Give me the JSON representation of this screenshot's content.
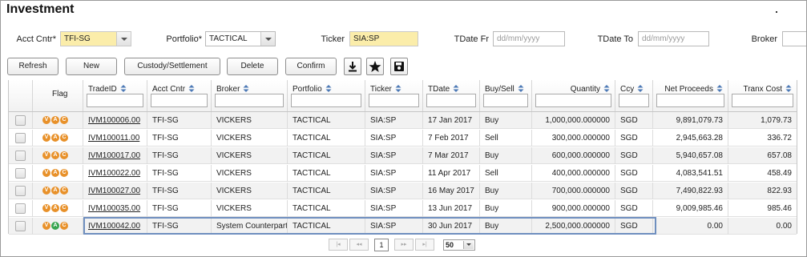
{
  "page": {
    "title": "Investment"
  },
  "filters": {
    "acct_cntr_label": "Acct Cntr*",
    "acct_cntr_value": "TFI-SG",
    "portfolio_label": "Portfolio*",
    "portfolio_value": "TACTICAL",
    "ticker_label": "Ticker",
    "ticker_value": "SIA:SP",
    "tdate_fr_label": "TDate Fr",
    "tdate_fr_placeholder": "dd/mm/yyyy",
    "tdate_to_label": "TDate To",
    "tdate_to_placeholder": "dd/mm/yyyy",
    "broker_label": "Broker"
  },
  "toolbar": {
    "refresh": "Refresh",
    "new": "New",
    "custody": "Custody/Settlement",
    "delete": "Delete",
    "confirm": "Confirm",
    "icons": [
      "download-icon",
      "star-icon",
      "save-icon"
    ]
  },
  "grid": {
    "columns": [
      "Flag",
      "TradeID",
      "Acct Cntr",
      "Broker",
      "Portfolio",
      "Ticker",
      "TDate",
      "Buy/Sell",
      "Quantity",
      "Ccy",
      "Net Proceeds",
      "Tranx Cost"
    ],
    "flag_letters": [
      "V",
      "A",
      "C"
    ],
    "flag_colors": {
      "orange": "#e8912a",
      "green": "#38a550"
    },
    "rows": [
      {
        "trade_id": "IVM100006.00",
        "acct": "TFI-SG",
        "broker": "VICKERS",
        "portfolio": "TACTICAL",
        "ticker": "SIA:SP",
        "tdate": "17 Jan 2017",
        "side": "Buy",
        "qty": "1,000,000.000000",
        "ccy": "SGD",
        "net": "9,891,079.73",
        "cost": "1,079.73"
      },
      {
        "trade_id": "IVM100011.00",
        "acct": "TFI-SG",
        "broker": "VICKERS",
        "portfolio": "TACTICAL",
        "ticker": "SIA:SP",
        "tdate": "7 Feb 2017",
        "side": "Sell",
        "qty": "300,000.000000",
        "ccy": "SGD",
        "net": "2,945,663.28",
        "cost": "336.72"
      },
      {
        "trade_id": "IVM100017.00",
        "acct": "TFI-SG",
        "broker": "VICKERS",
        "portfolio": "TACTICAL",
        "ticker": "SIA:SP",
        "tdate": "7 Mar 2017",
        "side": "Buy",
        "qty": "600,000.000000",
        "ccy": "SGD",
        "net": "5,940,657.08",
        "cost": "657.08"
      },
      {
        "trade_id": "IVM100022.00",
        "acct": "TFI-SG",
        "broker": "VICKERS",
        "portfolio": "TACTICAL",
        "ticker": "SIA:SP",
        "tdate": "11 Apr 2017",
        "side": "Sell",
        "qty": "400,000.000000",
        "ccy": "SGD",
        "net": "4,083,541.51",
        "cost": "458.49"
      },
      {
        "trade_id": "IVM100027.00",
        "acct": "TFI-SG",
        "broker": "VICKERS",
        "portfolio": "TACTICAL",
        "ticker": "SIA:SP",
        "tdate": "16 May 2017",
        "side": "Buy",
        "qty": "700,000.000000",
        "ccy": "SGD",
        "net": "7,490,822.93",
        "cost": "822.93"
      },
      {
        "trade_id": "IVM100035.00",
        "acct": "TFI-SG",
        "broker": "VICKERS",
        "portfolio": "TACTICAL",
        "ticker": "SIA:SP",
        "tdate": "13 Jun 2017",
        "side": "Buy",
        "qty": "900,000.000000",
        "ccy": "SGD",
        "net": "9,009,985.46",
        "cost": "985.46"
      },
      {
        "trade_id": "IVM100042.00",
        "acct": "TFI-SG",
        "broker": "System Counterparty",
        "portfolio": "TACTICAL",
        "ticker": "SIA:SP",
        "tdate": "30 Jun 2017",
        "side": "Buy",
        "qty": "2,500,000.000000",
        "ccy": "SGD",
        "net": "0.00",
        "cost": "0.00"
      }
    ]
  },
  "pager": {
    "page": "1",
    "page_size": "50"
  }
}
